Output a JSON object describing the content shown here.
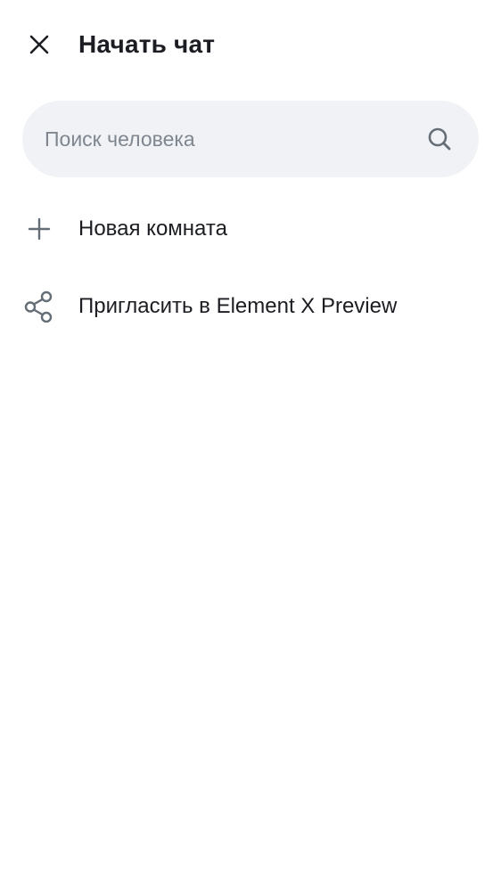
{
  "header": {
    "title": "Начать чат",
    "close_icon": "close-icon"
  },
  "search": {
    "placeholder": "Поиск человека",
    "value": "",
    "icon": "search-icon"
  },
  "actions": [
    {
      "label": "Новая комната",
      "icon": "plus-icon"
    },
    {
      "label": "Пригласить в Element X Preview",
      "icon": "share-icon"
    }
  ],
  "colors": {
    "background": "#ffffff",
    "text_primary": "#1b1d22",
    "text_secondary": "#7f868f",
    "search_bg": "#f0f2f5",
    "icon": "#656d77"
  }
}
